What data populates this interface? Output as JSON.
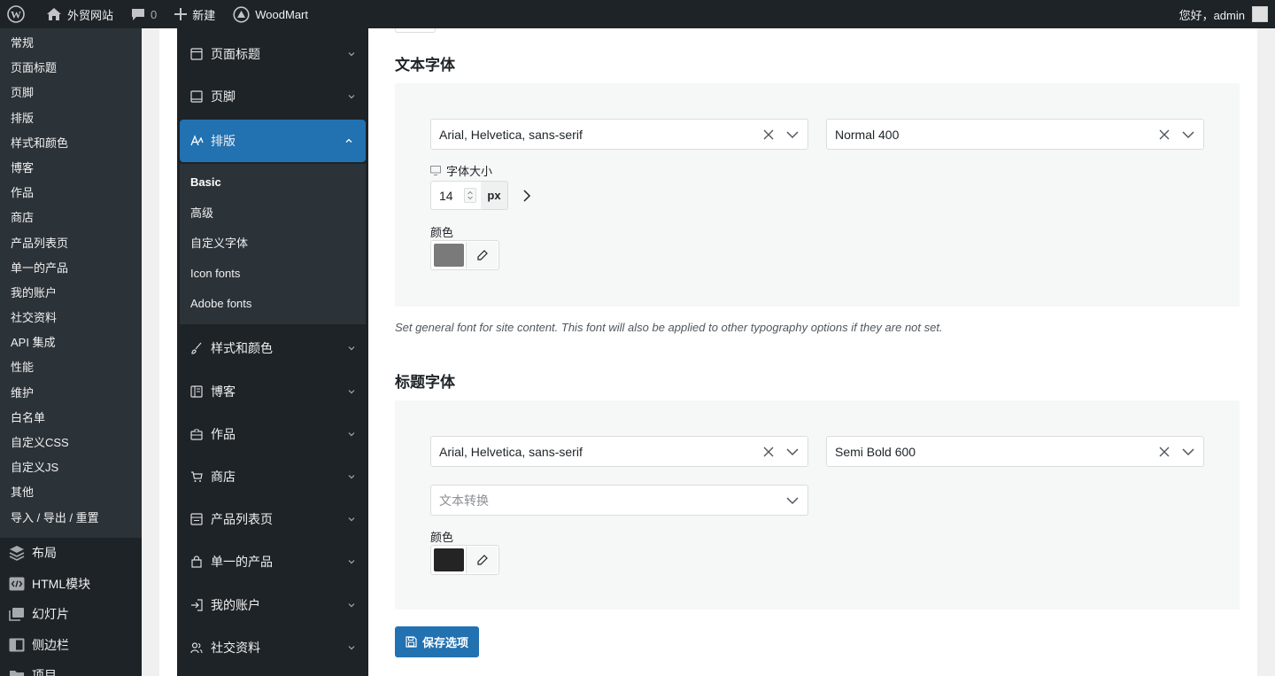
{
  "adminbar": {
    "site_name": "外贸网站",
    "comments_count": "0",
    "new_label": "新建",
    "plugin_label": "WoodMart",
    "greeting": "您好，admin"
  },
  "wp_menu": {
    "submenu": [
      "常规",
      "页面标题",
      "页脚",
      "排版",
      "样式和颜色",
      "博客",
      "作品",
      "商店",
      "产品列表页",
      "单一的产品",
      "我的账户",
      "社交资料",
      "API 集成",
      "性能",
      "维护",
      "白名单",
      "自定义CSS",
      "自定义JS",
      "其他",
      "导入 / 导出 / 重置"
    ],
    "top": [
      {
        "label": "布局",
        "icon": "layers-icon"
      },
      {
        "label": "HTML模块",
        "icon": "code-block-icon"
      },
      {
        "label": "幻灯片",
        "icon": "slides-icon"
      },
      {
        "label": "侧边栏",
        "icon": "sidebar-icon"
      },
      {
        "label": "项目",
        "icon": "folder-icon"
      }
    ]
  },
  "options_nav": {
    "items_before": [
      {
        "label": "页面标题",
        "icon": "page-title-icon"
      },
      {
        "label": "页脚",
        "icon": "footer-icon"
      }
    ],
    "active": {
      "label": "排版",
      "icon": "typography-icon"
    },
    "subitems": [
      "Basic",
      "高级",
      "自定义字体",
      "Icon fonts",
      "Adobe fonts"
    ],
    "items_after": [
      {
        "label": "样式和颜色",
        "icon": "brush-icon"
      },
      {
        "label": "博客",
        "icon": "blog-icon"
      },
      {
        "label": "作品",
        "icon": "portfolio-icon"
      },
      {
        "label": "商店",
        "icon": "cart-icon"
      },
      {
        "label": "产品列表页",
        "icon": "shop-page-icon"
      },
      {
        "label": "单一的产品",
        "icon": "bag-icon"
      },
      {
        "label": "我的账户",
        "icon": "account-icon"
      },
      {
        "label": "社交资料",
        "icon": "users-icon"
      }
    ]
  },
  "text_font": {
    "title": "文本字体",
    "family": "Arial, Helvetica, sans-serif",
    "weight": "Normal 400",
    "size_label": "字体大小",
    "size_value": "14",
    "size_unit": "px",
    "color_label": "颜色",
    "color": "#7a7a7a",
    "description": "Set general font for site content. This font will also be applied to other typography options if they are not set."
  },
  "heading_font": {
    "title": "标题字体",
    "family": "Arial, Helvetica, sans-serif",
    "weight": "Semi Bold 600",
    "transform_placeholder": "文本转换",
    "color_label": "颜色",
    "color": "#242424"
  },
  "save_label": "保存选项",
  "colors": {
    "accent": "#2271b1",
    "admin_dark": "#1d2327",
    "submenu_bg": "#2c3338"
  }
}
